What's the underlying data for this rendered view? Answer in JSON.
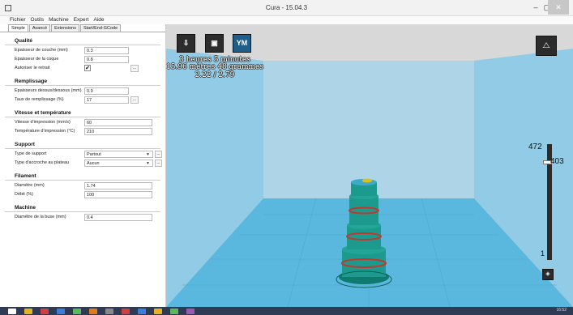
{
  "window": {
    "title": "Cura - 15.04.3",
    "minimize": "–",
    "maximize": "▢",
    "close": "✕"
  },
  "menu": [
    "Fichier",
    "Outils",
    "Machine",
    "Expert",
    "Aide"
  ],
  "tabs": [
    "Simple",
    "Avancé",
    "Extensions",
    "Start/End-GCode"
  ],
  "sections": {
    "quality": {
      "title": "Qualité",
      "layer_height_label": "Epaisseur de couche (mm)",
      "layer_height": "0.3",
      "shell_label": "Epaisseur de la coque",
      "shell": "0.8",
      "retract_label": "Autoriser le retrait",
      "retract": "✔"
    },
    "fill": {
      "title": "Remplissage",
      "bottom_top_label": "Epaisseurs dessus/dessous (mm)",
      "bottom_top": "0.9",
      "density_label": "Taux de remplissage (%)",
      "density": "17"
    },
    "speed": {
      "title": "Vitesse et température",
      "print_speed_label": "Vitesse d'impression (mm/s)",
      "print_speed": "60",
      "temp_label": "Température d'impression (°C)",
      "temp": "210"
    },
    "support": {
      "title": "Support",
      "type_label": "Type de support",
      "type": "Partout",
      "adhesion_label": "Type d'accroche au plateau",
      "adhesion": "Aucun"
    },
    "filament": {
      "title": "Filament",
      "diameter_label": "Diamètre (mm)",
      "diameter": "1.74",
      "flow_label": "Débit (%)",
      "flow": "100"
    },
    "machine": {
      "title": "Machine",
      "nozzle_label": "Diamètre de la buse (mm)",
      "nozzle": "0.4"
    }
  },
  "dots": "...",
  "viewport": {
    "ym_label": "YM",
    "print_time": "3 heures 5 minutes",
    "filament_usage": "15.96 mètres 48 grammes",
    "cost": "2.22 / 2.79",
    "layer_max": "472",
    "layer_current": "403",
    "layer_min": "1"
  },
  "colors": {
    "build_plate": "#5ab7dd",
    "walls": "#7fc8e8",
    "model_teal": "#1d9a8e",
    "model_red": "#c0392b"
  },
  "taskbar": {
    "clock": "16:52"
  }
}
